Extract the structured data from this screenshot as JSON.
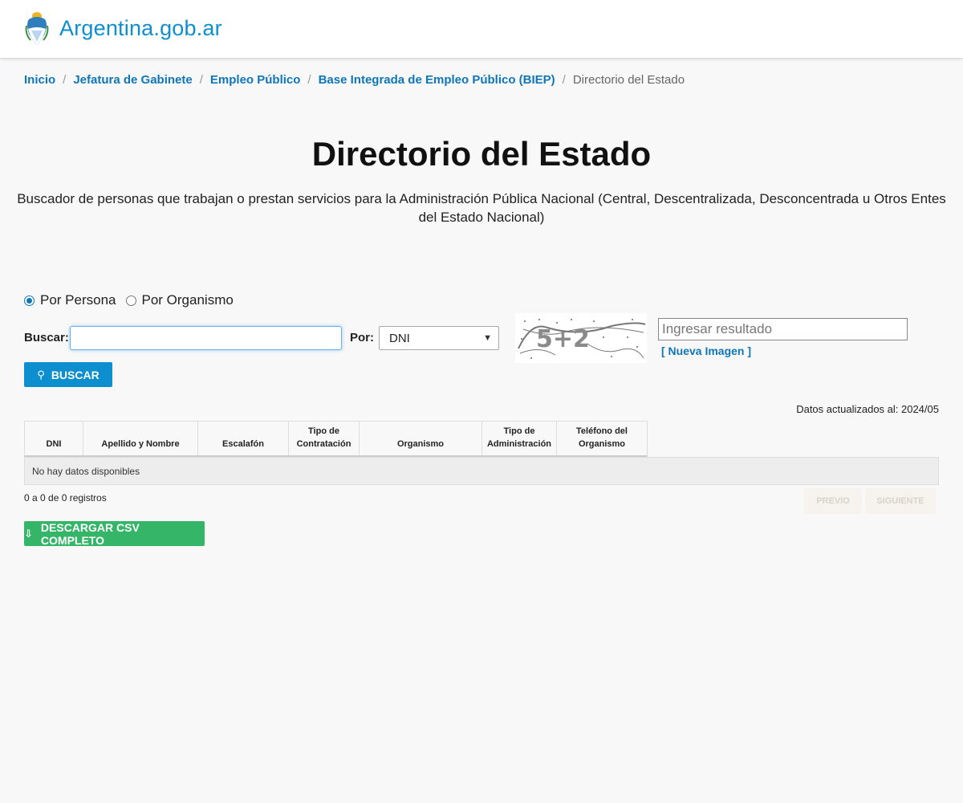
{
  "header": {
    "logo_text": "Argentina.gob.ar"
  },
  "breadcrumb": {
    "items": [
      "Inicio",
      "Jefatura de Gabinete",
      "Empleo Público",
      "Base Integrada de Empleo Público (BIEP)"
    ],
    "current": "Directorio del Estado",
    "separator": "/"
  },
  "page": {
    "title": "Directorio del Estado",
    "subtitle": "Buscador de personas que trabajan o prestan servicios para la Administración Pública Nacional (Central, Descentralizada, Desconcentrada u Otros Entes del Estado Nacional)"
  },
  "search": {
    "modes": [
      {
        "label": "Por Persona",
        "checked": true
      },
      {
        "label": "Por Organismo",
        "checked": false
      }
    ],
    "buscar_label": "Buscar:",
    "por_label": "Por:",
    "por_selected": "DNI",
    "captcha_placeholder": "Ingresar resultado",
    "nueva_imagen": "[ Nueva Imagen ]",
    "captcha_text": "5+2",
    "buscar_button": "BUSCAR"
  },
  "table": {
    "updated": "Datos actualizados al: 2024/05",
    "columns": [
      "DNI",
      "Apellido y Nombre",
      "Escalafón",
      "Tipo de Contratación",
      "Organismo",
      "Tipo de Administración",
      "Teléfono del Organismo"
    ],
    "empty": "No hay datos disponibles",
    "records": "0 a 0 de 0 registros",
    "prev": "PREVIO",
    "next": "SIGUIENTE"
  },
  "download": {
    "label": "DESCARGAR CSV COMPLETO"
  },
  "colors": {
    "brand": "#0d8fcf",
    "link": "#0f76b8",
    "csv": "#35b567"
  }
}
